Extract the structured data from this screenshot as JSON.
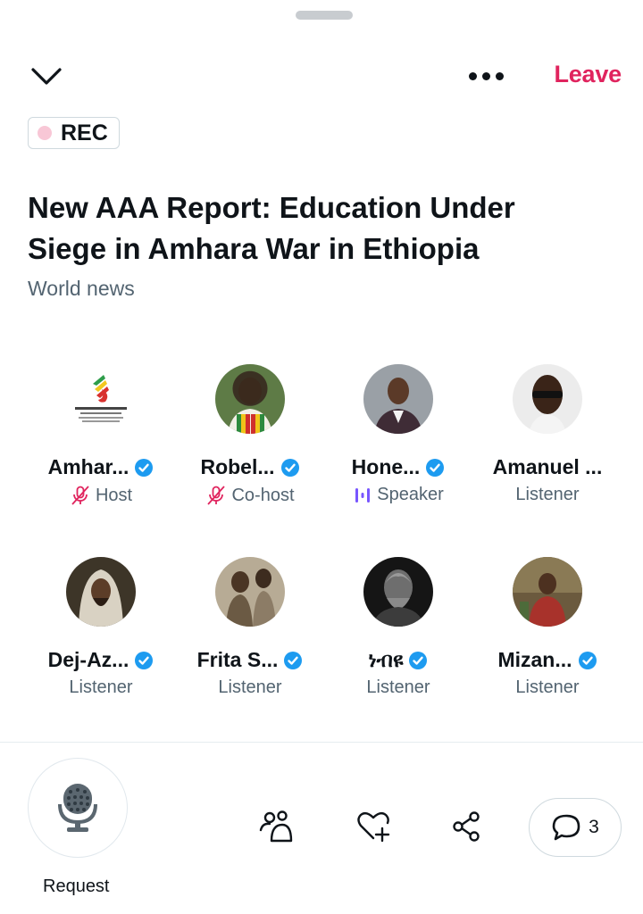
{
  "header": {
    "leave_label": "Leave",
    "rec_label": "REC",
    "accent_color": "#e0245e"
  },
  "space": {
    "title": "New AAA Report: Education Under Siege in Amhara War in Ethiopia",
    "category": "World news"
  },
  "participants": [
    {
      "name": "Amhar...",
      "role": "Host",
      "verified": true,
      "role_icon": "mic-off-icon",
      "avatar": "amhara-association-logo"
    },
    {
      "name": "Robel...",
      "role": "Co-host",
      "verified": true,
      "role_icon": "mic-off-icon",
      "avatar": "person-photo"
    },
    {
      "name": "Hone...",
      "role": "Speaker",
      "verified": true,
      "role_icon": "speaking-bars-icon",
      "avatar": "person-photo"
    },
    {
      "name": "Amanuel ...",
      "role": "Listener",
      "verified": false,
      "avatar": "person-photo"
    },
    {
      "name": "Dej-Az...",
      "role": "Listener",
      "verified": true,
      "avatar": "painting-photo"
    },
    {
      "name": "Frita S...",
      "role": "Listener",
      "verified": true,
      "avatar": "vintage-photo"
    },
    {
      "name": "ነብዩ",
      "role": "Listener",
      "verified": true,
      "avatar": "statue-photo"
    },
    {
      "name": "Mizan...",
      "role": "Listener",
      "verified": true,
      "avatar": "painting-photo"
    }
  ],
  "footer": {
    "request_label": "Request",
    "comments_count": "3"
  }
}
